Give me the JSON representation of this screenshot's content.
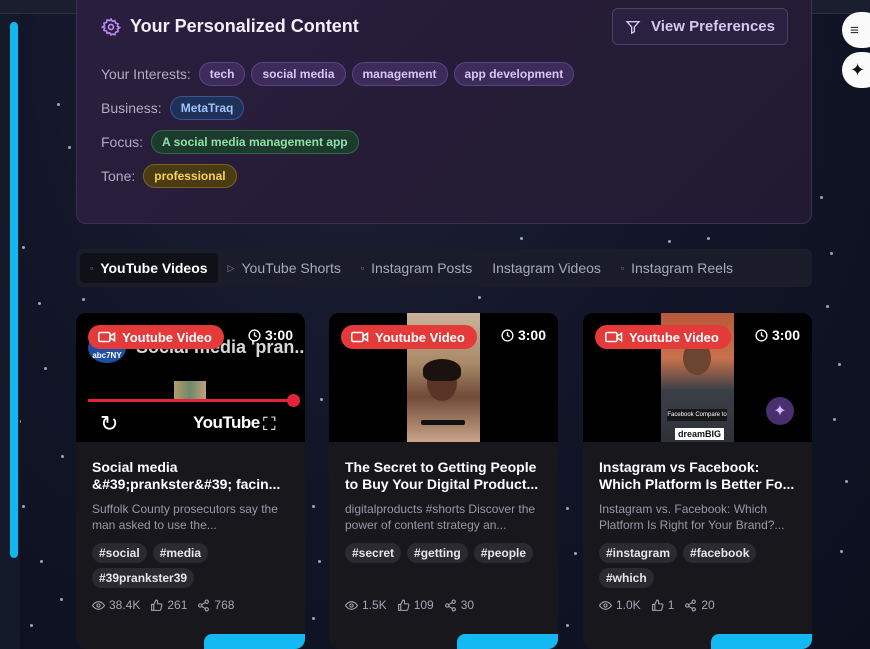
{
  "preferences": {
    "title": "Your Personalized Content",
    "view_button": "View Preferences",
    "interests_label": "Your Interests:",
    "interests": [
      "tech",
      "social media",
      "management",
      "app development"
    ],
    "business_label": "Business:",
    "business": "MetaTraq",
    "focus_label": "Focus:",
    "focus": "A social media management app",
    "tone_label": "Tone:",
    "tone": "professional"
  },
  "tabs": [
    "YouTube Videos",
    "YouTube Shorts",
    "Instagram Posts",
    "Instagram Videos",
    "Instagram Reels"
  ],
  "active_tab": "YouTube Videos",
  "cards": [
    {
      "badge": "Youtube Video",
      "duration": "3:00",
      "thumb_overlay": "Social media 'pran...",
      "thumb_logo": "abc7NY",
      "thumb_brand": "YouTube",
      "title": "Social media &#39;prankster&#39; facin...",
      "description": "Suffolk County prosecutors say the man asked to use the...",
      "tags": [
        "#social",
        "#media",
        "#39prankster39"
      ],
      "views": "38.4K",
      "likes": "261",
      "shares": "768"
    },
    {
      "badge": "Youtube Video",
      "duration": "3:00",
      "title": "The Secret to Getting People to Buy Your Digital Product...",
      "description": "digitalproducts #shorts Discover the power of content strategy an...",
      "tags": [
        "#secret",
        "#getting",
        "#people"
      ],
      "views": "1.5K",
      "likes": "109",
      "shares": "30"
    },
    {
      "badge": "Youtube Video",
      "duration": "3:00",
      "thumb_caption1": "Facebook Compare to",
      "thumb_caption2": "dreamBIG",
      "title": "Instagram vs Facebook: Which Platform Is Better Fo...",
      "description": "Instagram vs. Facebook: Which Platform Is Right for Your Brand?...",
      "tags": [
        "#instagram",
        "#facebook",
        "#which"
      ],
      "views": "1.0K",
      "likes": "1",
      "shares": "20"
    }
  ],
  "colors": {
    "accent_cyan": "#14b8f2",
    "badge_red": "#e43a3a",
    "purple_pill": "#3d2b5c",
    "blue_pill": "#1f3156",
    "green_pill": "#1c3b2c",
    "gold_pill": "#4a3b12"
  },
  "icons": {
    "gear": "gear-icon",
    "filter": "filter-icon",
    "video": "video-camera-icon",
    "clock": "clock-icon",
    "eye": "eye-icon",
    "thumbs_up": "thumbs-up-icon",
    "share": "share-icon",
    "quote": "quote-icon",
    "sparkle": "sparkle-icon"
  }
}
